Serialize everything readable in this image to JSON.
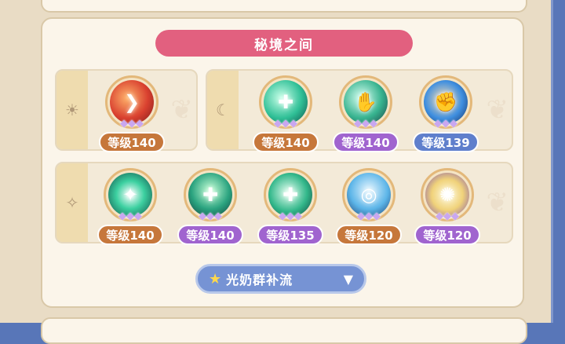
{
  "title": "秘境之间",
  "colors": {
    "title_bg": "#e2607f",
    "badge_orange": "#c6773b",
    "badge_purple": "#a064cf",
    "badge_blue": "#5f7fcc"
  },
  "groups": [
    {
      "icon": "sun-icon",
      "skills": [
        {
          "icon": "fire-slash-icon",
          "level": "等级140",
          "badge_color": "#c6773b",
          "orb": "radial-gradient(circle at 40% 40%, #ffb36b, #d9402f 55%, #7a1a1a)"
        }
      ]
    },
    {
      "icon": "moon-icon",
      "skills": [
        {
          "icon": "heal-cross-icon",
          "level": "等级140",
          "badge_color": "#c6773b",
          "orb": "radial-gradient(circle at 40% 40%, #c8ffe8, #2fbf96 55%, #0c4c47)"
        },
        {
          "icon": "hand-spark-icon",
          "level": "等级140",
          "badge_color": "#a064cf",
          "orb": "radial-gradient(circle at 40% 40%, #d8fff1, #37b38f 55%, #1a3e43)"
        },
        {
          "icon": "blue-flame-fist-icon",
          "level": "等级139",
          "badge_color": "#5f7fcc",
          "orb": "radial-gradient(circle at 45% 45%, #ffe0b0, #3f8fe0 55%, #142a5c)"
        }
      ]
    },
    {
      "icon": "sparkle-icon",
      "skills": [
        {
          "icon": "starburst-icon",
          "level": "等级140",
          "badge_color": "#c6773b",
          "orb": "radial-gradient(circle at 50% 50%, #ffffff, #3cd0a0 45%, #0e4a44)"
        },
        {
          "icon": "green-pillar-icon",
          "level": "等级140",
          "badge_color": "#a064cf",
          "orb": "radial-gradient(circle at 50% 40%, #c6ffd6, #2aa37f 55%, #143a3a)"
        },
        {
          "icon": "group-heal-icon",
          "level": "等级135",
          "badge_color": "#a064cf",
          "orb": "radial-gradient(circle at 45% 45%, #e6fff1, #32b78a 55%, #113e3a)"
        },
        {
          "icon": "light-ring-icon",
          "level": "等级120",
          "badge_color": "#c6773b",
          "orb": "radial-gradient(circle at 50% 40%, #e8f7ff, #5cb5e8 55%, #1a3a6e)"
        },
        {
          "icon": "light-rays-icon",
          "level": "等级120",
          "badge_color": "#a064cf",
          "orb": "radial-gradient(circle at 50% 50%, #fffbe0, #f0d27a 50%, #7d4fb0)"
        }
      ]
    }
  ],
  "style_select": {
    "star_icon": "star-icon",
    "label": "光奶群补流",
    "arrow_icon": "dropdown-triangle-icon"
  }
}
